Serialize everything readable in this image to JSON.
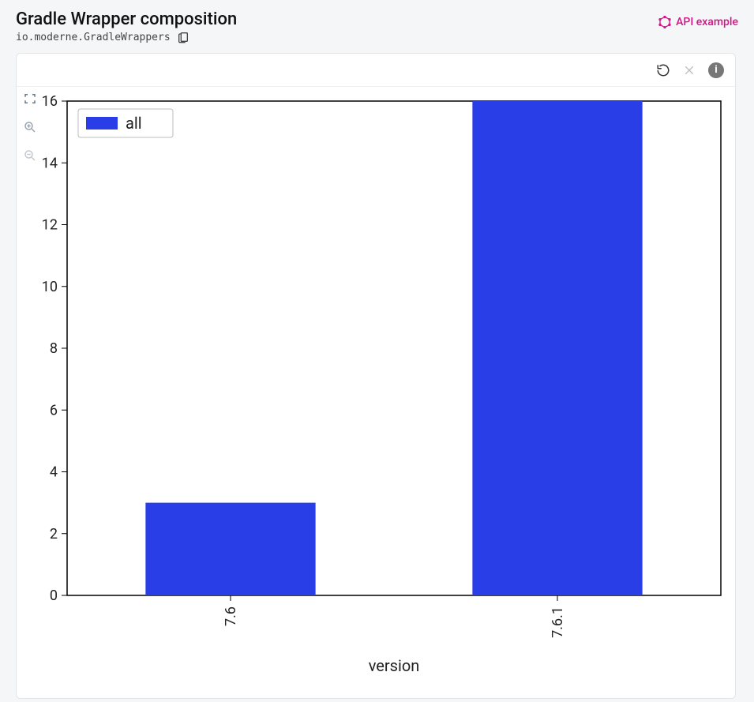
{
  "header": {
    "title": "Gradle Wrapper composition",
    "subtitle": "io.moderne.GradleWrappers",
    "api_link_label": "API example"
  },
  "toolbar": {
    "info_glyph": "i"
  },
  "chart_data": {
    "type": "bar",
    "categories": [
      "7.6",
      "7.6.1"
    ],
    "series": [
      {
        "name": "all",
        "values": [
          3,
          16
        ]
      }
    ],
    "xlabel": "version",
    "ylabel": "",
    "ylim": [
      0,
      16
    ],
    "y_ticks": [
      0,
      2,
      4,
      6,
      8,
      10,
      12,
      14,
      16
    ],
    "colors": {
      "all": "#2a3ee8"
    }
  }
}
